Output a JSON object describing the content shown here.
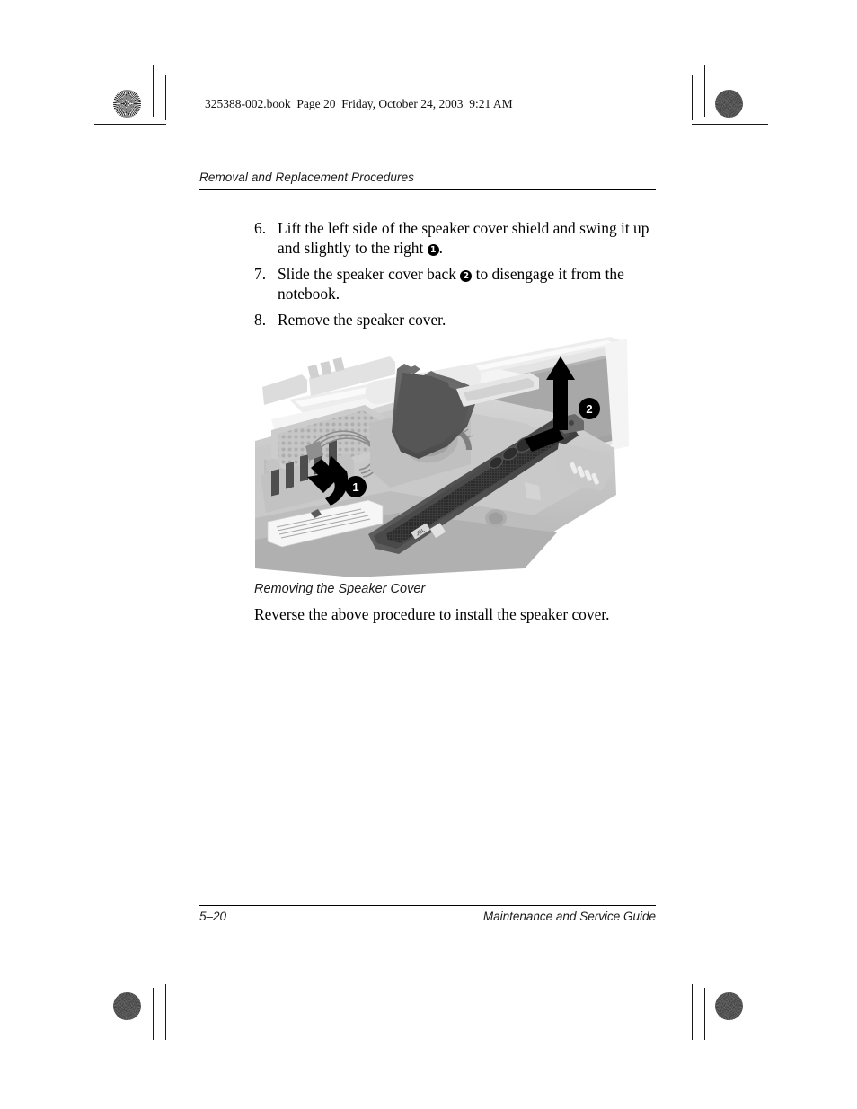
{
  "page": {
    "slug_line": "325388-002.book  Page 20  Friday, October 24, 2003  9:21 AM",
    "running_head": "Removal and Replacement Procedures",
    "footer_page_number": "5–20",
    "footer_title": "Maintenance and Service Guide"
  },
  "steps": [
    {
      "number": "6.",
      "text_before": "Lift the left side of the speaker cover shield and swing it up and slightly to the right ",
      "callout": "1",
      "text_after": "."
    },
    {
      "number": "7.",
      "text_before": "Slide the speaker cover back ",
      "callout": "2",
      "text_after": " to disengage it from the notebook."
    },
    {
      "number": "8.",
      "text_before": "Remove the speaker cover.",
      "callout": "",
      "text_after": ""
    }
  ],
  "figure": {
    "caption": "Removing the Speaker Cover",
    "alt": "Notebook with speaker cover being lifted and slid back",
    "callouts": [
      {
        "label": "1",
        "meaning": "swing speaker cover shield up and to the right"
      },
      {
        "label": "2",
        "meaning": "slide speaker cover back to disengage"
      }
    ],
    "label_text": "JBL"
  },
  "body_text": {
    "reverse_note": "Reverse the above procedure to install the speaker cover."
  },
  "colors": {
    "text": "#000000",
    "rule": "#000000",
    "callout_fill": "#000000",
    "callout_text": "#ffffff",
    "photo_light": "#d8d8d8",
    "photo_mid": "#a8a8a8",
    "photo_dark": "#4a4a4a"
  }
}
